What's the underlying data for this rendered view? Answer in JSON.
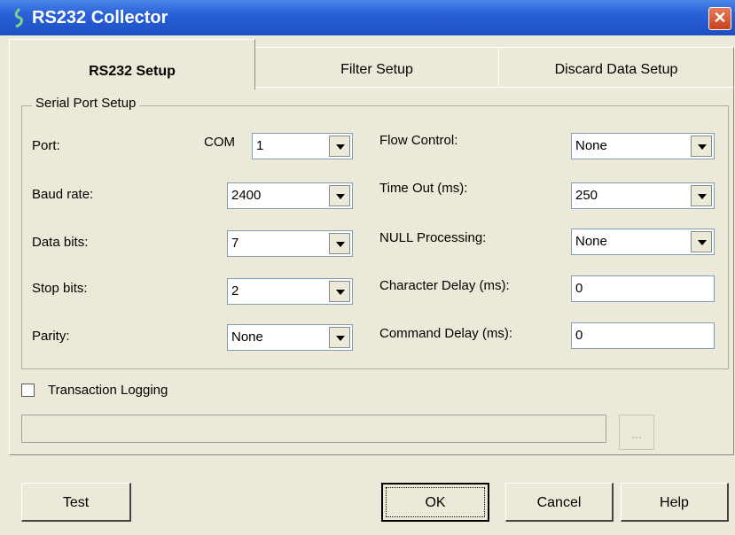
{
  "window": {
    "title": "RS232 Collector",
    "close_label": "✕"
  },
  "tabs": [
    {
      "label": "RS232 Setup",
      "active": true
    },
    {
      "label": "Filter Setup",
      "active": false
    },
    {
      "label": "Discard Data Setup",
      "active": false
    }
  ],
  "serial_port": {
    "group_label": "Serial Port Setup",
    "port_label": "Port:",
    "port_prefix": "COM",
    "port_value": "1",
    "baud_label": "Baud rate:",
    "baud_value": "2400",
    "data_bits_label": "Data bits:",
    "data_bits_value": "7",
    "stop_bits_label": "Stop bits:",
    "stop_bits_value": "2",
    "parity_label": "Parity:",
    "parity_value": "None",
    "flow_label": "Flow Control:",
    "flow_value": "None",
    "timeout_label": "Time Out (ms):",
    "timeout_value": "250",
    "null_label": "NULL Processing:",
    "null_value": "None",
    "char_delay_label": "Character Delay (ms):",
    "char_delay_value": "0",
    "cmd_delay_label": "Command Delay (ms):",
    "cmd_delay_value": "0"
  },
  "logging": {
    "label": "Transaction Logging",
    "checked": false,
    "path": "",
    "browse_label": "..."
  },
  "buttons": {
    "test": "Test",
    "ok": "OK",
    "cancel": "Cancel",
    "help": "Help"
  }
}
